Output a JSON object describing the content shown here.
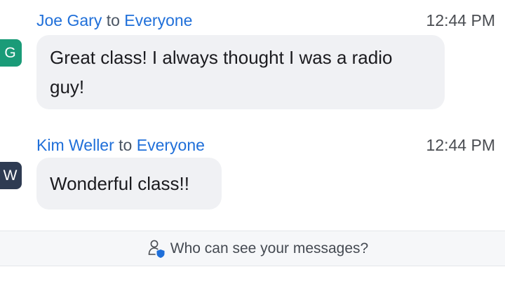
{
  "messages": [
    {
      "avatar_initial": "G",
      "avatar_color": "#1a9b78",
      "sender": "Joe Gary",
      "to_word": "to",
      "recipient": "Everyone",
      "time": "12:44 PM",
      "lines": [
        "Great class! I always thought I was a radio",
        "guy!"
      ]
    },
    {
      "avatar_initial": "W",
      "avatar_color": "#2e3b52",
      "sender": "Kim Weller",
      "to_word": "to",
      "recipient": "Everyone",
      "time": "12:44 PM",
      "lines": [
        "Wonderful class!!"
      ]
    }
  ],
  "visibility_notice": {
    "icon": "person-shield-icon",
    "label": "Who can see your messages?",
    "accent": "#1f6fd9"
  }
}
